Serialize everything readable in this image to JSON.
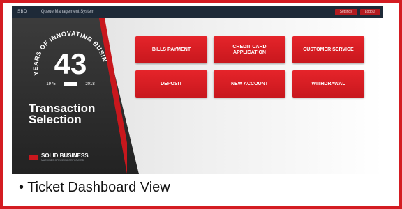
{
  "topbar": {
    "logo_text": "SBD",
    "app_title": "Queue Management System",
    "buttons": [
      "Settings",
      "Logout"
    ]
  },
  "badge": {
    "arc_text": "YEARS OF INNOVATING BUSINESS",
    "number": "43",
    "start_year": "1975",
    "end_year": "2018"
  },
  "left": {
    "heading_line1": "Transaction",
    "heading_line2": "Selection",
    "brand": "SOLID BUSINESS",
    "brand_sub": "MACHINES OFFICE INCORPORATED"
  },
  "buttons": [
    "BILLS PAYMENT",
    "CREDIT CARD APPLICATION",
    "CUSTOMER SERVICE",
    "DEPOSIT",
    "NEW ACCOUNT",
    "WITHDRAWAL"
  ],
  "caption": "• Ticket Dashboard View",
  "colors": {
    "accent": "#c8171d",
    "frame": "#d41c22",
    "topbar": "#1e2a38",
    "panel": "#2b2b2b"
  }
}
